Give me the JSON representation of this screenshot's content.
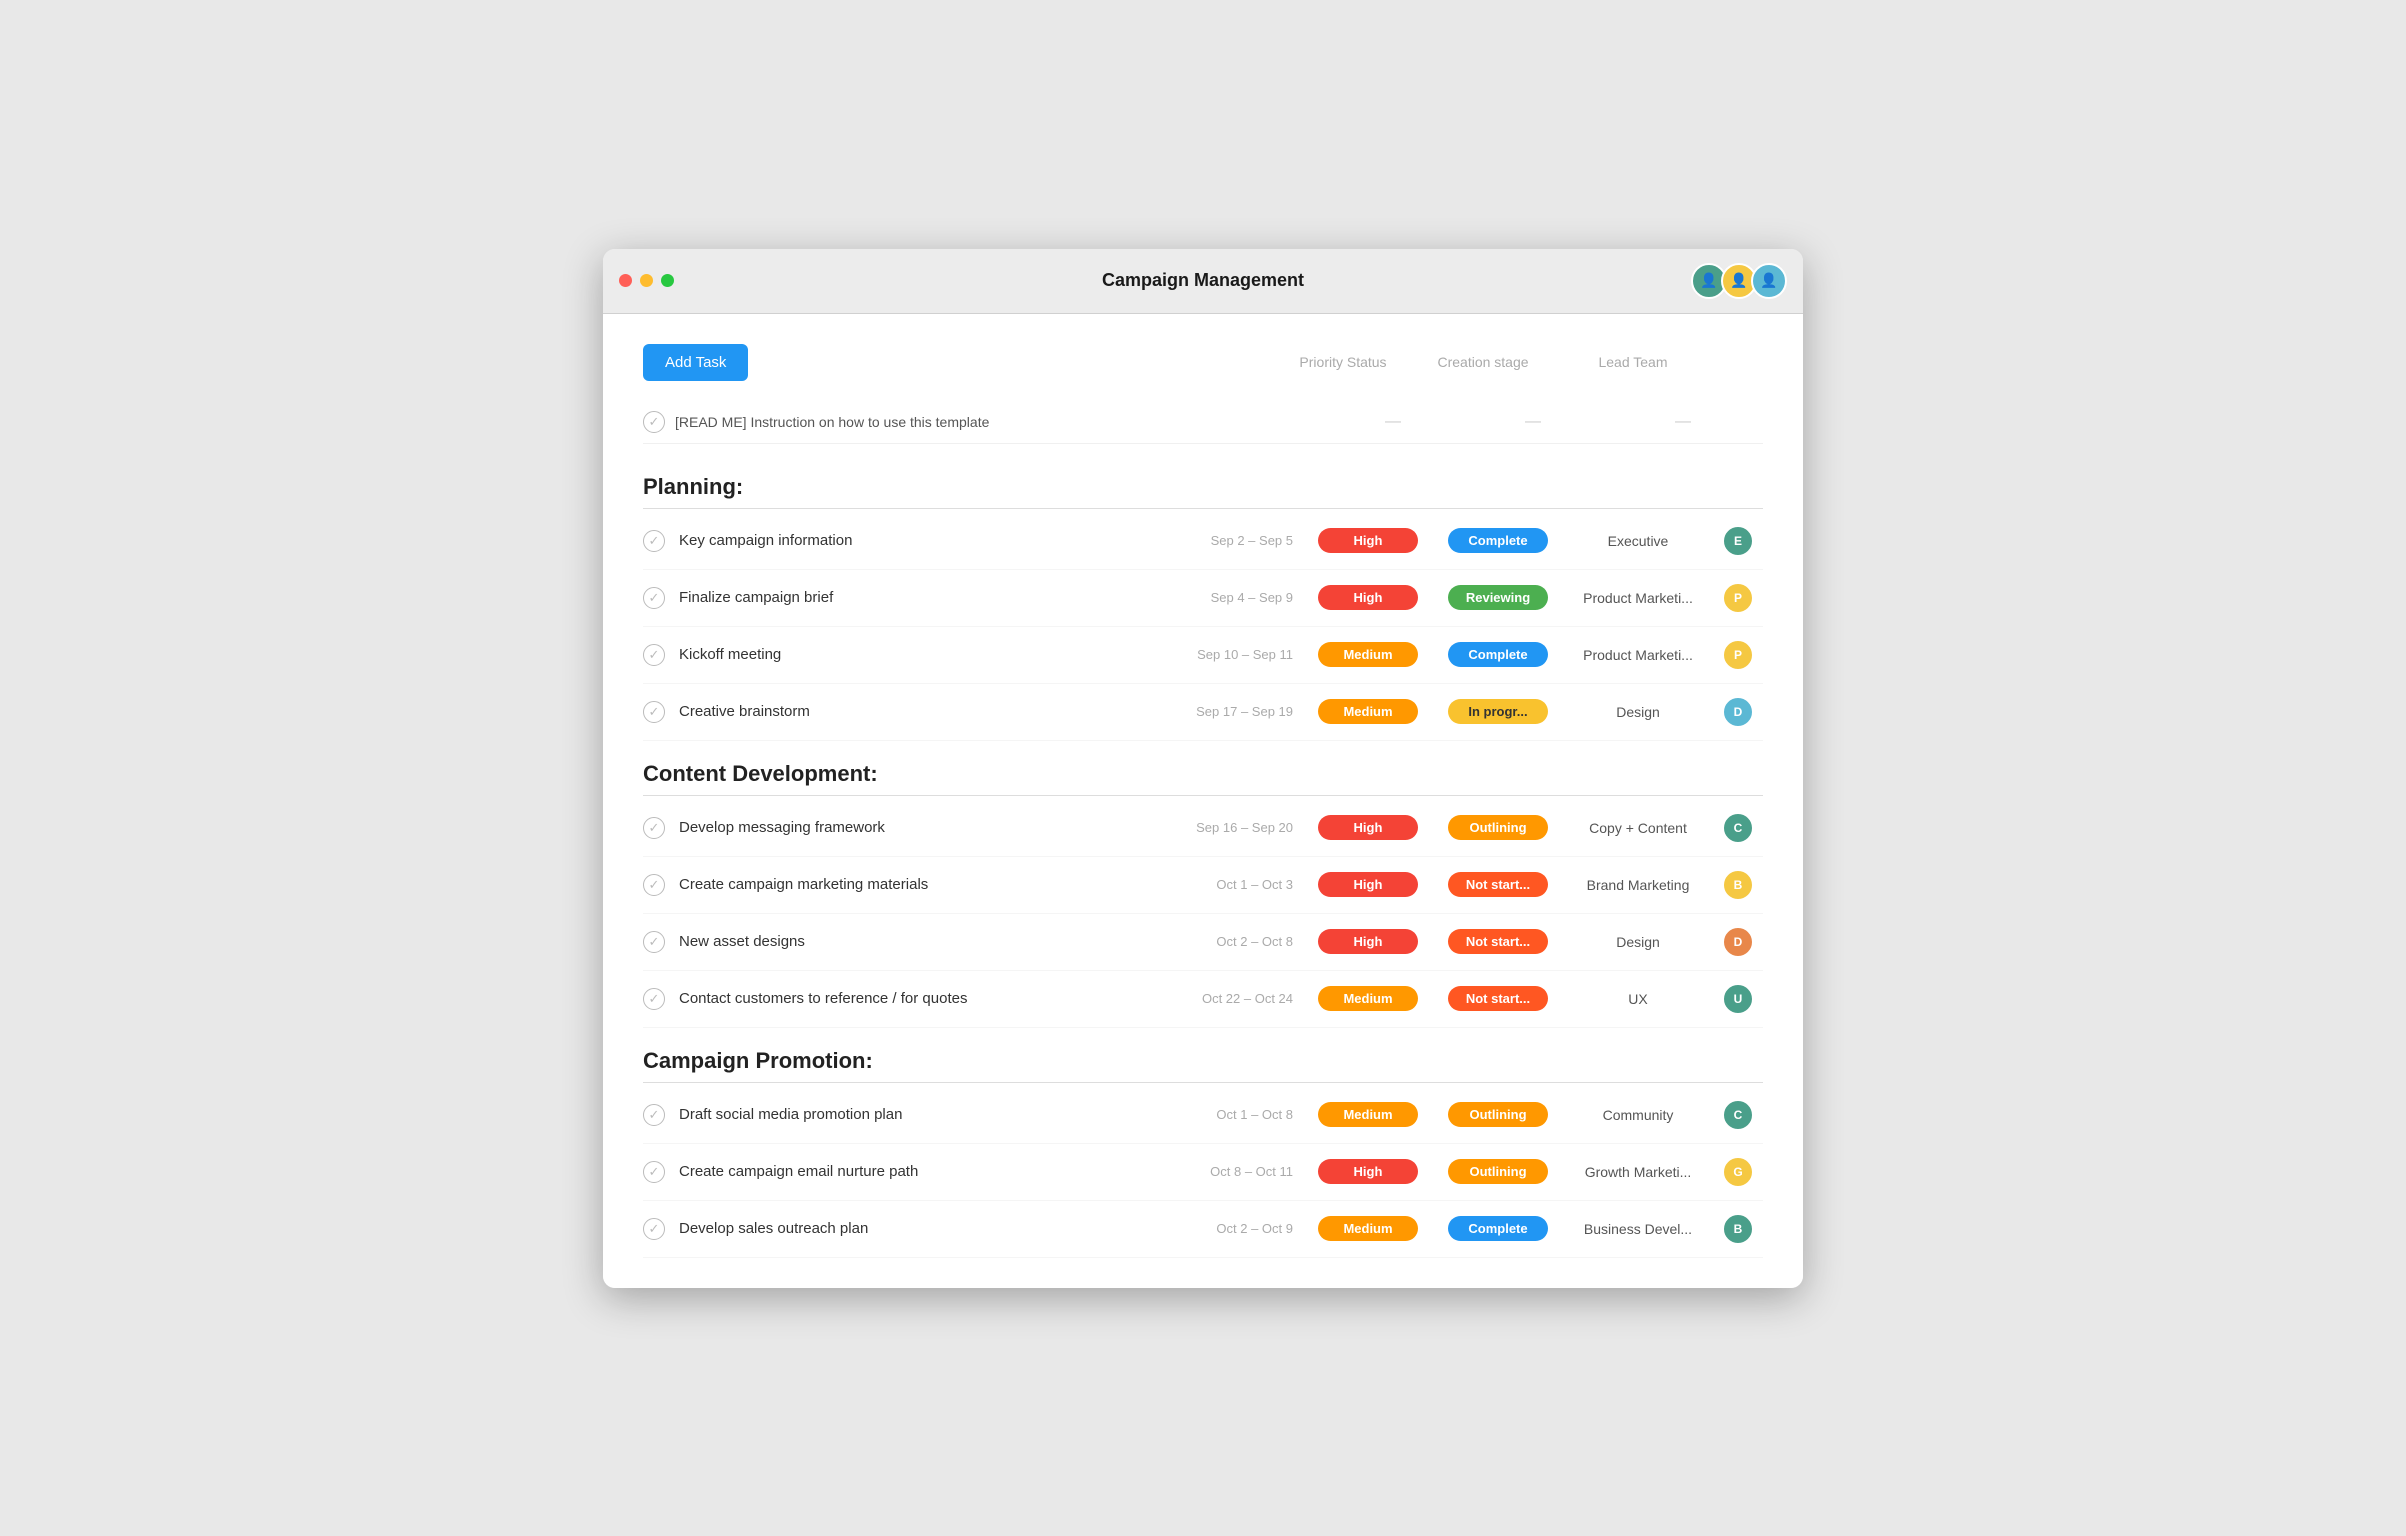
{
  "window": {
    "title": "Campaign Management",
    "traffic_lights": [
      "red",
      "yellow",
      "green"
    ]
  },
  "toolbar": {
    "add_task_label": "Add Task",
    "col_priority": "Priority Status",
    "col_creation": "Creation stage",
    "col_team": "Lead Team"
  },
  "readme": {
    "name": "[READ ME] Instruction on how to use this template"
  },
  "sections": [
    {
      "title": "Planning:",
      "tasks": [
        {
          "name": "Key campaign information",
          "date": "Sep 2 – Sep 5",
          "priority": "High",
          "priority_class": "badge-high",
          "status": "Complete",
          "status_class": "badge-complete",
          "team": "Executive",
          "avatar_color": "#4a9f8a",
          "avatar_initial": "E"
        },
        {
          "name": "Finalize campaign brief",
          "date": "Sep 4 – Sep 9",
          "priority": "High",
          "priority_class": "badge-high",
          "status": "Reviewing",
          "status_class": "badge-reviewing",
          "team": "Product Marketi...",
          "avatar_color": "#f5c842",
          "avatar_initial": "P"
        },
        {
          "name": "Kickoff meeting",
          "date": "Sep 10 – Sep 11",
          "priority": "Medium",
          "priority_class": "badge-medium",
          "status": "Complete",
          "status_class": "badge-complete",
          "team": "Product Marketi...",
          "avatar_color": "#f5c842",
          "avatar_initial": "P"
        },
        {
          "name": "Creative brainstorm",
          "date": "Sep 17 – Sep 19",
          "priority": "Medium",
          "priority_class": "badge-medium",
          "status": "In progr...",
          "status_class": "badge-inprogress",
          "team": "Design",
          "avatar_color": "#5bb8d4",
          "avatar_initial": "D"
        }
      ]
    },
    {
      "title": "Content Development:",
      "tasks": [
        {
          "name": "Develop messaging framework",
          "date": "Sep 16 – Sep 20",
          "priority": "High",
          "priority_class": "badge-high",
          "status": "Outlining",
          "status_class": "badge-outlining",
          "team": "Copy + Content",
          "avatar_color": "#4a9f8a",
          "avatar_initial": "C"
        },
        {
          "name": "Create campaign marketing materials",
          "date": "Oct 1 – Oct 3",
          "priority": "High",
          "priority_class": "badge-high",
          "status": "Not start...",
          "status_class": "badge-notstart",
          "team": "Brand Marketing",
          "avatar_color": "#f5c842",
          "avatar_initial": "B"
        },
        {
          "name": "New asset designs",
          "date": "Oct 2 – Oct 8",
          "priority": "High",
          "priority_class": "badge-high",
          "status": "Not start...",
          "status_class": "badge-notstart",
          "team": "Design",
          "avatar_color": "#e8874a",
          "avatar_initial": "D"
        },
        {
          "name": "Contact customers to reference / for quotes",
          "date": "Oct 22 – Oct 24",
          "priority": "Medium",
          "priority_class": "badge-medium",
          "status": "Not start...",
          "status_class": "badge-notstart",
          "team": "UX",
          "avatar_color": "#4a9f8a",
          "avatar_initial": "U"
        }
      ]
    },
    {
      "title": "Campaign Promotion:",
      "tasks": [
        {
          "name": "Draft social media promotion plan",
          "date": "Oct 1 – Oct 8",
          "priority": "Medium",
          "priority_class": "badge-medium",
          "status": "Outlining",
          "status_class": "badge-outlining",
          "team": "Community",
          "avatar_color": "#4a9f8a",
          "avatar_initial": "C"
        },
        {
          "name": "Create campaign email nurture path",
          "date": "Oct 8 – Oct 11",
          "priority": "High",
          "priority_class": "badge-high",
          "status": "Outlining",
          "status_class": "badge-outlining",
          "team": "Growth Marketi...",
          "avatar_color": "#f5c842",
          "avatar_initial": "G"
        },
        {
          "name": "Develop sales outreach plan",
          "date": "Oct 2 – Oct 9",
          "priority": "Medium",
          "priority_class": "badge-medium",
          "status": "Complete",
          "status_class": "badge-complete",
          "team": "Business Devel...",
          "avatar_color": "#4a9f8a",
          "avatar_initial": "B"
        }
      ]
    }
  ]
}
